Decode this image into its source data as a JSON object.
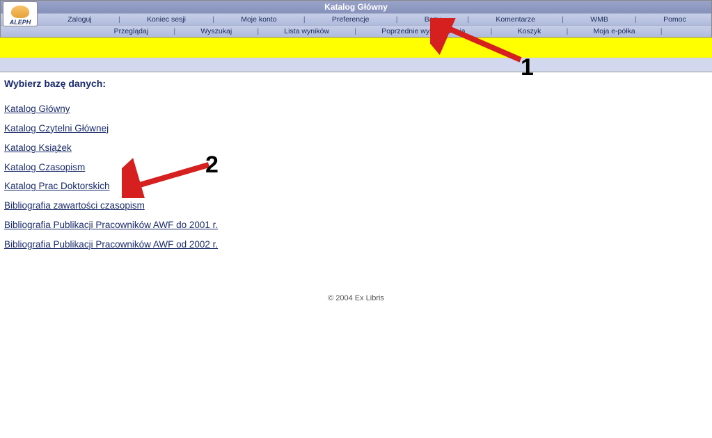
{
  "header": {
    "title": "Katalog Główny",
    "logo_text": "ALEPH"
  },
  "nav": {
    "row1": [
      "Zaloguj",
      "Koniec sesji",
      "Moje konto",
      "Preferencje",
      "Bazy",
      "Komentarze",
      "WMB",
      "Pomoc"
    ],
    "row2": [
      "Przeglądaj",
      "Wyszukaj",
      "Lista wyników",
      "Poprzednie wyszukiwania",
      "Koszyk",
      "Moja e-półka"
    ]
  },
  "page": {
    "heading": "Wybierz bazę danych:",
    "databases": [
      "Katalog Główny",
      "Katalog Czytelni Głównej",
      "Katalog Książek",
      "Katalog Czasopism",
      "Katalog Prac Doktorskich",
      "Bibliografia zawartości czasopism",
      "Bibliografia Publikacji Pracowników AWF do 2001 r.",
      "Bibliografia Publikacji Pracowników AWF od 2002 r."
    ]
  },
  "annotations": {
    "label1": "1",
    "label2": "2"
  },
  "footer": {
    "copyright": "© 2004 Ex Libris"
  }
}
